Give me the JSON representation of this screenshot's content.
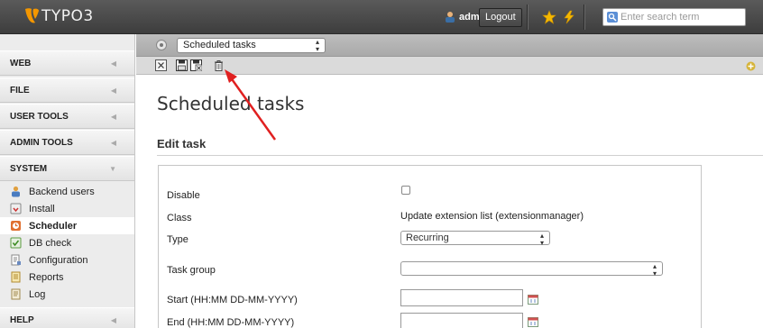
{
  "app": {
    "logo_text": "TYPO3"
  },
  "topbar": {
    "username": "admin",
    "logout_label": "Logout",
    "search_placeholder": "Enter search term"
  },
  "sidebar": {
    "sections": [
      "WEB",
      "FILE",
      "USER TOOLS",
      "ADMIN TOOLS",
      "SYSTEM",
      "HELP"
    ],
    "system_modules": [
      {
        "label": "Backend users",
        "icon": "backend-users-icon"
      },
      {
        "label": "Install",
        "icon": "install-icon"
      },
      {
        "label": "Scheduler",
        "icon": "scheduler-icon",
        "active": true
      },
      {
        "label": "DB check",
        "icon": "db-check-icon"
      },
      {
        "label": "Configuration",
        "icon": "configuration-icon"
      },
      {
        "label": "Reports",
        "icon": "reports-icon"
      },
      {
        "label": "Log",
        "icon": "log-icon"
      }
    ]
  },
  "docheader": {
    "function_menu_selected": "Scheduled tasks",
    "buttons": [
      "close-icon",
      "save-icon",
      "save-and-close-icon",
      "delete-icon"
    ]
  },
  "main": {
    "title": "Scheduled tasks",
    "section_title": "Edit task",
    "fields": {
      "disable_label": "Disable",
      "class_label": "Class",
      "class_value": "Update extension list (extensionmanager)",
      "type_label": "Type",
      "type_value": "Recurring",
      "task_group_label": "Task group",
      "task_group_value": "",
      "start_label": "Start (HH:MM DD-MM-YYYY)",
      "start_value": "",
      "end_label": "End (HH:MM DD-MM-YYYY)",
      "end_value": ""
    }
  },
  "colors": {
    "topbar": "#4a4a4a",
    "accent_orange": "#f49700",
    "annotation_arrow": "#e02020",
    "star": "#f5b800"
  }
}
